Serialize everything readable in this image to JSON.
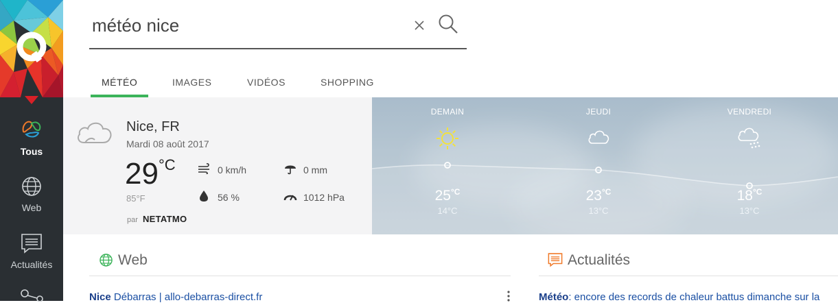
{
  "search": {
    "query": "météo nice"
  },
  "sidebar": {
    "items": [
      {
        "label": "Tous",
        "icon": "tous-icon",
        "active": true
      },
      {
        "label": "Web",
        "icon": "globe-icon",
        "active": false
      },
      {
        "label": "Actualités",
        "icon": "news-icon",
        "active": false
      }
    ]
  },
  "tabs": [
    {
      "label": "MÉTÉO",
      "active": true
    },
    {
      "label": "IMAGES",
      "active": false
    },
    {
      "label": "VIDÉOS",
      "active": false
    },
    {
      "label": "SHOPPING",
      "active": false
    }
  ],
  "weather": {
    "city": "Nice, FR",
    "date": "Mardi 08 août 2017",
    "temp": "29",
    "unit": "°C",
    "temp_f": "85°F",
    "wind": "0 km/h",
    "rain": "0 mm",
    "humidity": "56 %",
    "pressure": "1012 hPa",
    "source_prefix": "par",
    "source": "NETATMO"
  },
  "forecast": [
    {
      "day": "DEMAIN",
      "icon": "sun-icon",
      "hi": "25",
      "hi_unit": "°C",
      "lo": "14°C"
    },
    {
      "day": "JEUDI",
      "icon": "cloud-icon",
      "hi": "23",
      "hi_unit": "°C",
      "lo": "13°C"
    },
    {
      "day": "VENDREDI",
      "icon": "snow-cloud-icon",
      "hi": "18",
      "hi_unit": "°C",
      "lo": "13°C"
    }
  ],
  "sections": {
    "web_title": "Web",
    "news_title": "Actualités"
  },
  "results": {
    "web_first_bold": "Nice",
    "web_first_rest": " Débarras | allo-debarras-direct.fr",
    "news_first_bold": "Météo",
    "news_first_rest": ": encore des records de chaleur battus dimanche sur la"
  },
  "colors": {
    "accent": "#3cb45a",
    "sidebar_bg": "#2a2f33",
    "link": "#1a4fa3"
  }
}
